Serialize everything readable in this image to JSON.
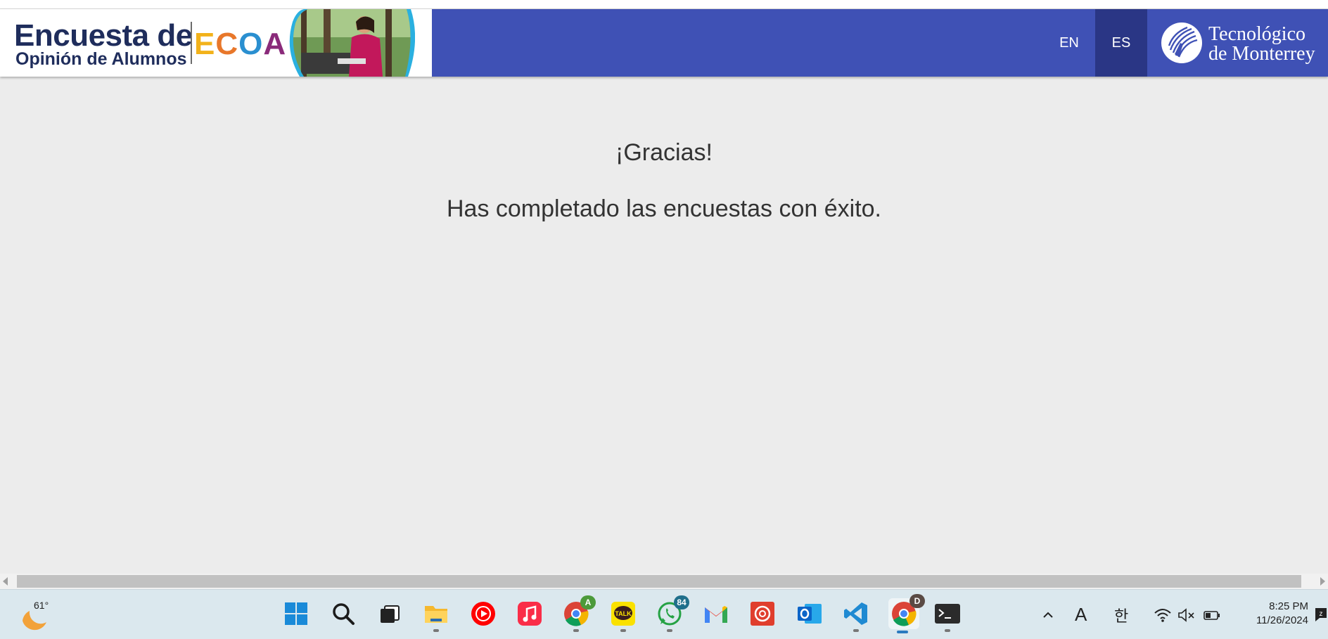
{
  "header": {
    "brand_title": "Encuesta de",
    "brand_subtitle": "Opinión de Alumnos",
    "brand_acronym": [
      "E",
      "C",
      "O",
      "A"
    ],
    "languages": [
      {
        "label": "EN",
        "active": false
      },
      {
        "label": "ES",
        "active": true
      }
    ],
    "university_line1": "Tecnológico",
    "university_line2": "de Monterrey",
    "bar_color": "#3f51b5"
  },
  "main": {
    "title": "¡Gracias!",
    "message": "Has completado las encuestas con éxito."
  },
  "taskbar": {
    "weather_temp": "61°",
    "apps": [
      {
        "name": "start-icon"
      },
      {
        "name": "search-icon"
      },
      {
        "name": "task-view-icon"
      },
      {
        "name": "file-explorer-icon"
      },
      {
        "name": "youtube-music-icon"
      },
      {
        "name": "apple-music-icon"
      },
      {
        "name": "chrome-profile-a-icon",
        "badge": "A"
      },
      {
        "name": "kakaotalk-icon",
        "label": "TALK"
      },
      {
        "name": "whatsapp-icon",
        "badge": "84"
      },
      {
        "name": "gmail-icon"
      },
      {
        "name": "canvas-icon"
      },
      {
        "name": "outlook-icon"
      },
      {
        "name": "vscode-icon"
      },
      {
        "name": "chrome-profile-d-icon",
        "badge": "D"
      },
      {
        "name": "terminal-icon"
      }
    ],
    "tray": {
      "ime_latin": "A",
      "ime_korean": "한"
    },
    "time": "8:25 PM",
    "date": "11/26/2024"
  }
}
